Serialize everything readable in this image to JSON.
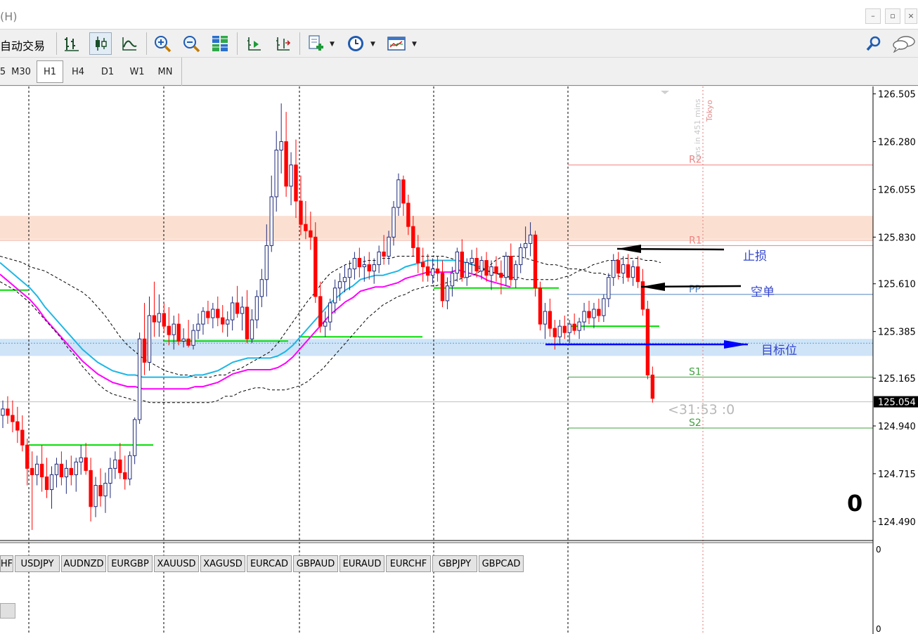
{
  "window": {
    "title_fragment": "(H)",
    "minimize_glyph": "–",
    "restore_glyph": "▫",
    "close_glyph": "×"
  },
  "toolbar": {
    "auto_trading_label": "自动交易",
    "icons": [
      "bar-chart-icon",
      "candlestick-icon",
      "line-chart-icon",
      "zoom-in-icon",
      "zoom-out-icon",
      "tile-windows-icon",
      "auto-scroll-icon",
      "chart-shift-icon",
      "indicators-icon",
      "periods-icon",
      "templates-icon",
      "search-icon",
      "chat-icon"
    ]
  },
  "timeframes": {
    "items": [
      "5",
      "M30",
      "H1",
      "H4",
      "D1",
      "W1",
      "MN"
    ],
    "active": "H1"
  },
  "chart_data": {
    "type": "candlestick",
    "price_axis": {
      "ticks": [
        "126.505",
        "126.280",
        "126.055",
        "125.830",
        "125.610",
        "125.385",
        "125.165",
        "124.940",
        "124.715",
        "124.490"
      ],
      "current_price": "125.054",
      "min": 124.4,
      "max": 126.54
    },
    "candles": [
      [
        124.99,
        125.06,
        124.93,
        125.02
      ],
      [
        125.02,
        125.08,
        124.95,
        124.99
      ],
      [
        124.99,
        125.06,
        124.91,
        124.96
      ],
      [
        124.96,
        125.03,
        124.86,
        124.92
      ],
      [
        124.92,
        124.99,
        124.82,
        124.85
      ],
      [
        124.85,
        124.88,
        124.66,
        124.74
      ],
      [
        124.74,
        124.82,
        124.45,
        124.71
      ],
      [
        124.71,
        124.8,
        124.66,
        124.76
      ],
      [
        124.76,
        124.85,
        124.63,
        124.7
      ],
      [
        124.7,
        124.79,
        124.6,
        124.64
      ],
      [
        124.64,
        124.75,
        124.55,
        124.71
      ],
      [
        124.71,
        124.79,
        124.65,
        124.76
      ],
      [
        124.76,
        124.82,
        124.66,
        124.7
      ],
      [
        124.7,
        124.78,
        124.62,
        124.74
      ],
      [
        124.74,
        124.8,
        124.66,
        124.71
      ],
      [
        124.71,
        124.79,
        124.63,
        124.77
      ],
      [
        124.77,
        124.85,
        124.71,
        124.79
      ],
      [
        124.79,
        124.86,
        124.71,
        124.73
      ],
      [
        124.73,
        124.79,
        124.49,
        124.56
      ],
      [
        124.56,
        124.7,
        124.51,
        124.66
      ],
      [
        124.66,
        124.74,
        124.56,
        124.61
      ],
      [
        124.61,
        124.72,
        124.53,
        124.67
      ],
      [
        124.67,
        124.79,
        124.6,
        124.74
      ],
      [
        124.74,
        124.82,
        124.69,
        124.78
      ],
      [
        124.78,
        124.86,
        124.69,
        124.72
      ],
      [
        124.72,
        124.8,
        124.64,
        124.69
      ],
      [
        124.69,
        124.82,
        124.66,
        124.8
      ],
      [
        124.8,
        124.98,
        124.76,
        124.97
      ],
      [
        124.97,
        125.38,
        124.95,
        125.35
      ],
      [
        125.35,
        125.52,
        125.18,
        125.24
      ],
      [
        125.24,
        125.55,
        125.2,
        125.46
      ],
      [
        125.46,
        125.62,
        125.36,
        125.43
      ],
      [
        125.43,
        125.56,
        125.36,
        125.47
      ],
      [
        125.47,
        125.52,
        125.38,
        125.41
      ],
      [
        125.41,
        125.5,
        125.32,
        125.37
      ],
      [
        125.37,
        125.46,
        125.3,
        125.42
      ],
      [
        125.42,
        125.47,
        125.32,
        125.34
      ],
      [
        125.34,
        125.4,
        125.31,
        125.35
      ],
      [
        125.35,
        125.44,
        125.31,
        125.32
      ],
      [
        125.32,
        125.42,
        125.3,
        125.39
      ],
      [
        125.39,
        125.47,
        125.35,
        125.42
      ],
      [
        125.42,
        125.5,
        125.37,
        125.48
      ],
      [
        125.48,
        125.53,
        125.42,
        125.45
      ],
      [
        125.45,
        125.52,
        125.4,
        125.49
      ],
      [
        125.49,
        125.55,
        125.41,
        125.45
      ],
      [
        125.45,
        125.51,
        125.38,
        125.42
      ],
      [
        125.42,
        125.48,
        125.36,
        125.44
      ],
      [
        125.44,
        125.55,
        125.39,
        125.52
      ],
      [
        125.52,
        125.6,
        125.45,
        125.47
      ],
      [
        125.47,
        125.55,
        125.39,
        125.5
      ],
      [
        125.5,
        125.58,
        125.33,
        125.35
      ],
      [
        125.35,
        125.49,
        125.33,
        125.44
      ],
      [
        125.44,
        125.58,
        125.4,
        125.55
      ],
      [
        125.55,
        125.68,
        125.5,
        125.63
      ],
      [
        125.63,
        125.89,
        125.55,
        125.79
      ],
      [
        125.79,
        126.12,
        125.76,
        126.02
      ],
      [
        126.02,
        126.33,
        125.95,
        126.24
      ],
      [
        126.24,
        126.46,
        126.13,
        126.28
      ],
      [
        126.28,
        126.42,
        126.02,
        126.07
      ],
      [
        126.07,
        126.23,
        125.98,
        126.17
      ],
      [
        126.17,
        126.29,
        125.92,
        126.0
      ],
      [
        126.0,
        126.12,
        125.84,
        125.89
      ],
      [
        125.89,
        126.0,
        125.82,
        125.86
      ],
      [
        125.86,
        125.95,
        125.77,
        125.83
      ],
      [
        125.83,
        125.9,
        125.52,
        125.55
      ],
      [
        125.55,
        125.62,
        125.38,
        125.41
      ],
      [
        125.41,
        125.48,
        125.36,
        125.43
      ],
      [
        125.43,
        125.54,
        125.39,
        125.52
      ],
      [
        125.52,
        125.63,
        125.47,
        125.59
      ],
      [
        125.59,
        125.66,
        125.53,
        125.62
      ],
      [
        125.62,
        125.7,
        125.57,
        125.64
      ],
      [
        125.64,
        125.72,
        125.58,
        125.68
      ],
      [
        125.68,
        125.76,
        125.63,
        125.73
      ],
      [
        125.73,
        125.78,
        125.64,
        125.69
      ],
      [
        125.69,
        125.74,
        125.62,
        125.7
      ],
      [
        125.7,
        125.76,
        125.63,
        125.67
      ],
      [
        125.67,
        125.73,
        125.61,
        125.7
      ],
      [
        125.7,
        125.79,
        125.66,
        125.76
      ],
      [
        125.76,
        125.84,
        125.7,
        125.74
      ],
      [
        125.74,
        125.86,
        125.7,
        125.83
      ],
      [
        125.83,
        126.0,
        125.79,
        125.97
      ],
      [
        125.97,
        126.13,
        125.93,
        126.1
      ],
      [
        126.1,
        126.12,
        125.93,
        125.99
      ],
      [
        125.99,
        126.03,
        125.84,
        125.88
      ],
      [
        125.88,
        125.93,
        125.74,
        125.78
      ],
      [
        125.78,
        125.84,
        125.66,
        125.71
      ],
      [
        125.71,
        125.78,
        125.62,
        125.69
      ],
      [
        125.69,
        125.75,
        125.62,
        125.65
      ],
      [
        125.65,
        125.73,
        125.61,
        125.68
      ],
      [
        125.68,
        125.74,
        125.62,
        125.66
      ],
      [
        125.66,
        125.72,
        125.5,
        125.53
      ],
      [
        125.53,
        125.64,
        125.49,
        125.6
      ],
      [
        125.6,
        125.69,
        125.55,
        125.66
      ],
      [
        125.66,
        125.78,
        125.62,
        125.76
      ],
      [
        125.76,
        125.82,
        125.62,
        125.64
      ],
      [
        125.64,
        125.73,
        125.6,
        125.71
      ],
      [
        125.71,
        125.77,
        125.66,
        125.73
      ],
      [
        125.73,
        125.78,
        125.64,
        125.67
      ],
      [
        125.67,
        125.74,
        125.63,
        125.72
      ],
      [
        125.72,
        125.76,
        125.62,
        125.65
      ],
      [
        125.65,
        125.72,
        125.58,
        125.69
      ],
      [
        125.69,
        125.74,
        125.62,
        125.66
      ],
      [
        125.66,
        125.72,
        125.56,
        125.64
      ],
      [
        125.64,
        125.76,
        125.6,
        125.74
      ],
      [
        125.74,
        125.8,
        125.6,
        125.63
      ],
      [
        125.63,
        125.72,
        125.59,
        125.7
      ],
      [
        125.7,
        125.8,
        125.66,
        125.78
      ],
      [
        125.78,
        125.88,
        125.73,
        125.8
      ],
      [
        125.8,
        125.9,
        125.74,
        125.84
      ],
      [
        125.84,
        125.86,
        125.55,
        125.59
      ],
      [
        125.59,
        125.62,
        125.39,
        125.42
      ],
      [
        125.42,
        125.52,
        125.35,
        125.48
      ],
      [
        125.48,
        125.54,
        125.36,
        125.4
      ],
      [
        125.4,
        125.44,
        125.3,
        125.36
      ],
      [
        125.36,
        125.44,
        125.32,
        125.41
      ],
      [
        125.41,
        125.46,
        125.35,
        125.38
      ],
      [
        125.38,
        125.44,
        125.33,
        125.42
      ],
      [
        125.42,
        125.47,
        125.37,
        125.39
      ],
      [
        125.39,
        125.45,
        125.35,
        125.43
      ],
      [
        125.43,
        125.52,
        125.39,
        125.48
      ],
      [
        125.48,
        125.53,
        125.42,
        125.45
      ],
      [
        125.45,
        125.52,
        125.4,
        125.49
      ],
      [
        125.49,
        125.54,
        125.43,
        125.46
      ],
      [
        125.46,
        125.56,
        125.43,
        125.54
      ],
      [
        125.54,
        125.66,
        125.5,
        125.64
      ],
      [
        125.64,
        125.75,
        125.6,
        125.72
      ],
      [
        125.72,
        125.76,
        125.63,
        125.66
      ],
      [
        125.66,
        125.74,
        125.61,
        125.7
      ],
      [
        125.7,
        125.75,
        125.62,
        125.64
      ],
      [
        125.64,
        125.72,
        125.6,
        125.69
      ],
      [
        125.69,
        125.74,
        125.59,
        125.62
      ],
      [
        125.62,
        125.68,
        125.46,
        125.49
      ],
      [
        125.49,
        125.53,
        125.16,
        125.18
      ],
      [
        125.18,
        125.22,
        125.05,
        125.07
      ]
    ],
    "upper_band": [
      125.74,
      125.73,
      125.72,
      125.71,
      125.69,
      125.68,
      125.67,
      125.65,
      125.63,
      125.61,
      125.59,
      125.57,
      125.54,
      125.5,
      125.46,
      125.41,
      125.36,
      125.32,
      125.29,
      125.26,
      125.24,
      125.22,
      125.2,
      125.19,
      125.18,
      125.18,
      125.17,
      125.17,
      125.17,
      125.18,
      125.18,
      125.2,
      125.21,
      125.23,
      125.25,
      125.27,
      125.29,
      125.33,
      125.38,
      125.43,
      125.48,
      125.53,
      125.57,
      125.62,
      125.66,
      125.68,
      125.7,
      125.71,
      125.71,
      125.72,
      125.72,
      125.73,
      125.73,
      125.74,
      125.74,
      125.74,
      125.74,
      125.74,
      125.74,
      125.74,
      125.73,
      125.72,
      125.71,
      125.7,
      125.68,
      125.67,
      125.66,
      125.65,
      125.64,
      125.64,
      125.63,
      125.63,
      125.63,
      125.63,
      125.63,
      125.64,
      125.65,
      125.67,
      125.68,
      125.7,
      125.71,
      125.72,
      125.72,
      125.73,
      125.73,
      125.73,
      125.72,
      125.72,
      125.71
    ],
    "lower_band": [
      125.62,
      125.6,
      125.58,
      125.55,
      125.52,
      125.48,
      125.44,
      125.4,
      125.36,
      125.31,
      125.27,
      125.22,
      125.18,
      125.14,
      125.11,
      125.09,
      125.08,
      125.07,
      125.06,
      125.06,
      125.05,
      125.05,
      125.05,
      125.05,
      125.05,
      125.05,
      125.05,
      125.05,
      125.05,
      125.06,
      125.08,
      125.08,
      125.1,
      125.11,
      125.12,
      125.12,
      125.11,
      125.11,
      125.11,
      125.12,
      125.13,
      125.15,
      125.18,
      125.21,
      125.25,
      125.29,
      125.33,
      125.37,
      125.41,
      125.45,
      125.48,
      125.51,
      125.53,
      125.55,
      125.56,
      125.58,
      125.59,
      125.6,
      125.6,
      125.61,
      125.62,
      125.63,
      125.64,
      125.65,
      125.67,
      125.69,
      125.72,
      125.74,
      125.74,
      125.74,
      125.73,
      125.72,
      125.71,
      125.7,
      125.7,
      125.69,
      125.68,
      125.68,
      125.67,
      125.66,
      125.66,
      125.65,
      125.65,
      125.64
    ],
    "ma": [
      125.71,
      125.68,
      125.65,
      125.62,
      125.59,
      125.55,
      125.5,
      125.46,
      125.42,
      125.38,
      125.34,
      125.3,
      125.27,
      125.24,
      125.22,
      125.2,
      125.19,
      125.18,
      125.18,
      125.17,
      125.17,
      125.17,
      125.17,
      125.17,
      125.17,
      125.17,
      125.18,
      125.18,
      125.19,
      125.2,
      125.22,
      125.24,
      125.25,
      125.26,
      125.26,
      125.26,
      125.26,
      125.27,
      125.29,
      125.32,
      125.36,
      125.4,
      125.44,
      125.48,
      125.52,
      125.55,
      125.58,
      125.6,
      125.63,
      125.64,
      125.65,
      125.65,
      125.66,
      125.67,
      125.69,
      125.7,
      125.71,
      125.72,
      125.72,
      125.72,
      125.72,
      125.72,
      125.71,
      125.7,
      125.69,
      125.67,
      125.66,
      125.65,
      125.64
    ],
    "pivot_levels": [
      {
        "label": "R2",
        "price": 126.17,
        "color": "#f08080"
      },
      {
        "label": "R1",
        "price": 125.79,
        "color": "#f08080"
      },
      {
        "label": "PP",
        "price": 125.56,
        "color": "#4f81bd"
      },
      {
        "label": "S1",
        "price": 125.17,
        "color": "#40a040"
      },
      {
        "label": "S2",
        "price": 124.93,
        "color": "#40a040"
      }
    ],
    "annotations": {
      "stop_loss": "止损",
      "short_order": "空单",
      "target": "目标位",
      "countdown": "<31:53 :0",
      "session_text": "ens in 451 mins",
      "session_name": "Tokyo",
      "big_number": "0"
    },
    "resistance_zone": [
      125.82,
      125.93
    ],
    "support_zone": [
      125.27,
      125.35
    ],
    "colors": {
      "bull": "#1f2b7a",
      "bear": "#ff0000",
      "upper_band": "#ff00ff",
      "ma": "#1cb7e6",
      "channel": "#000000",
      "support_line": "#00dd00",
      "arrow_blue": "#0000ff"
    }
  },
  "indicator": {
    "top_value": "0",
    "bottom_value": "0"
  },
  "symbol_tabs": [
    "HF",
    "USDJPY",
    "AUDNZD",
    "EURGBP",
    "XAUUSD",
    "XAGUSD",
    "EURCAD",
    "GBPAUD",
    "EURAUD",
    "EURCHF",
    "GBPJPY",
    "GBPCAD"
  ]
}
